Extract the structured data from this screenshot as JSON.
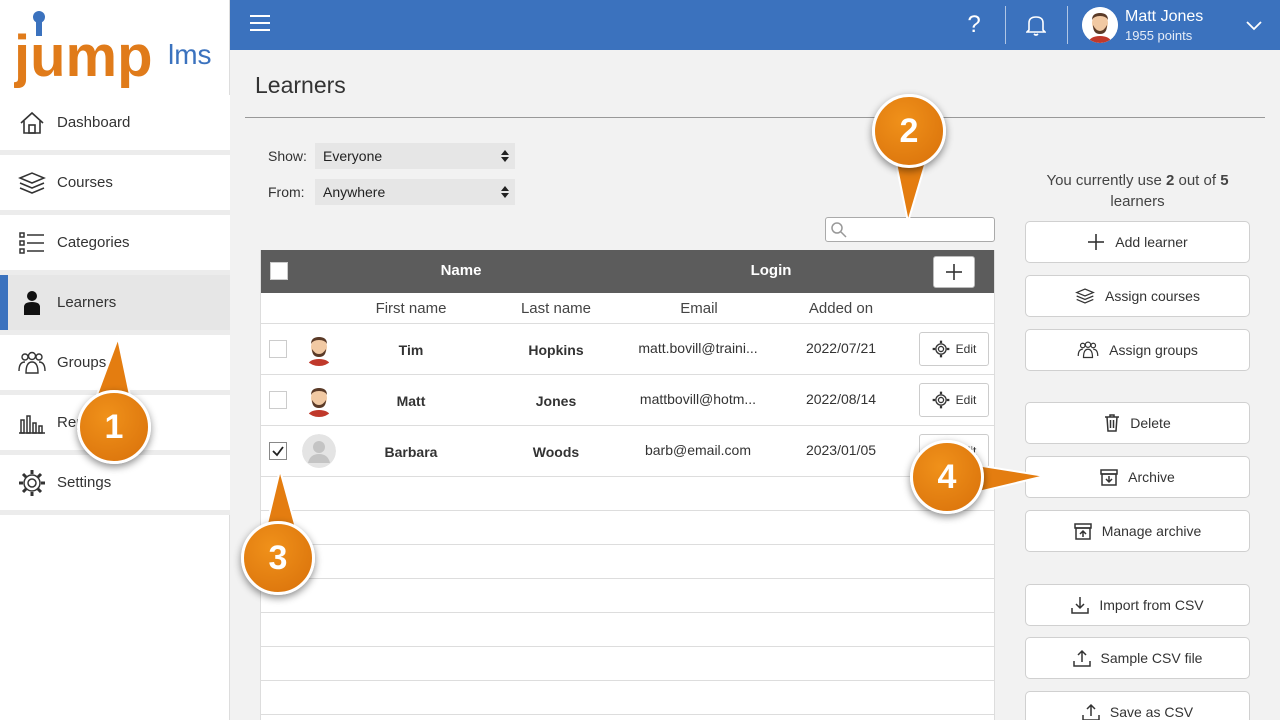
{
  "app": {
    "logo_text_main": "jump",
    "logo_text_sub": "lms"
  },
  "sidebar": {
    "items": [
      {
        "label": "Dashboard"
      },
      {
        "label": "Courses"
      },
      {
        "label": "Categories"
      },
      {
        "label": "Learners"
      },
      {
        "label": "Groups"
      },
      {
        "label": "Reports"
      },
      {
        "label": "Settings"
      }
    ]
  },
  "topbar": {
    "help_label": "?",
    "user_name": "Matt Jones",
    "user_points": "1955 points"
  },
  "page": {
    "title": "Learners"
  },
  "filters": {
    "show_label": "Show:",
    "show_value": "Everyone",
    "from_label": "From:",
    "from_value": "Anywhere"
  },
  "table": {
    "header_name": "Name",
    "header_login": "Login",
    "columns": {
      "first_name": "First name",
      "last_name": "Last name",
      "email": "Email",
      "added_on": "Added on"
    },
    "edit_label": "Edit",
    "rows": [
      {
        "first": "Tim",
        "last": "Hopkins",
        "email": "matt.bovill@traini...",
        "added": "2022/07/21",
        "checked": false
      },
      {
        "first": "Matt",
        "last": "Jones",
        "email": "mattbovill@hotm...",
        "added": "2022/08/14",
        "checked": false
      },
      {
        "first": "Barbara",
        "last": "Woods",
        "email": "barb@email.com",
        "added": "2023/01/05",
        "checked": true
      }
    ]
  },
  "usage": {
    "prefix": "You currently use ",
    "used": "2",
    "middle": " out of ",
    "total": "5",
    "suffix": " learners"
  },
  "actions": {
    "add_learner": "Add learner",
    "assign_courses": "Assign courses",
    "assign_groups": "Assign groups",
    "delete": "Delete",
    "archive": "Archive",
    "manage_archive": "Manage archive",
    "import_csv": "Import from CSV",
    "sample_csv": "Sample CSV file",
    "save_csv": "Save as CSV"
  },
  "callouts": [
    "1",
    "2",
    "3",
    "4"
  ],
  "colors": {
    "brand_blue": "#3b72be",
    "callout_orange": "#e47d10",
    "logo_orange": "#e07b1a",
    "logo_blue": "#3b72be"
  }
}
